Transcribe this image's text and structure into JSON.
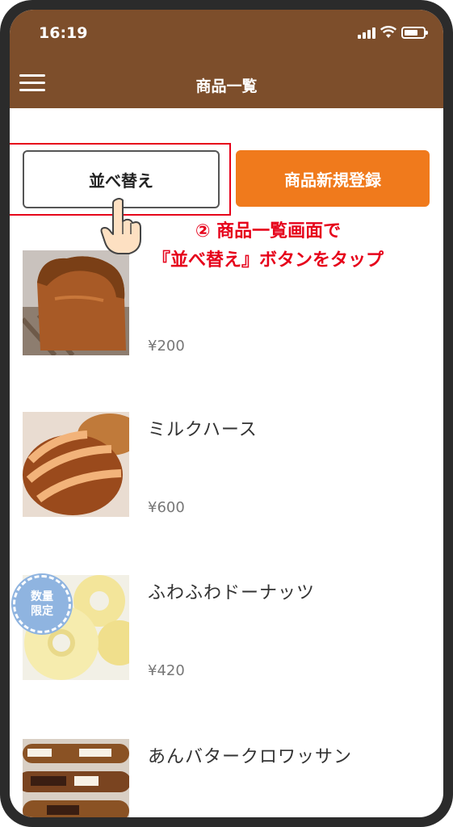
{
  "status_bar": {
    "time": "16:19"
  },
  "header": {
    "title": "商品一覧",
    "menu_icon": "hamburger-menu-icon"
  },
  "toolbar": {
    "sort_label": "並べ替え",
    "new_product_label": "商品新規登録"
  },
  "annotation": {
    "line1": "② 商品一覧画面で",
    "line2": "『並べ替え』ボタンをタップ"
  },
  "products": [
    {
      "name": "",
      "price": "¥200",
      "image": "bread-loaf"
    },
    {
      "name": "ミルクハース",
      "price": "¥600",
      "image": "milk-hearth-bread"
    },
    {
      "name": "ふわふわドーナッツ",
      "price": "¥420",
      "image": "donuts",
      "badge": [
        "数量",
        "限定"
      ]
    },
    {
      "name": "あんバタークロワッサン",
      "price": "",
      "image": "croissant"
    }
  ],
  "colors": {
    "header": "#7d4e2b",
    "accent": "#f07a1c",
    "annotation": "#e6001a",
    "badge": "#8fb4e0"
  }
}
